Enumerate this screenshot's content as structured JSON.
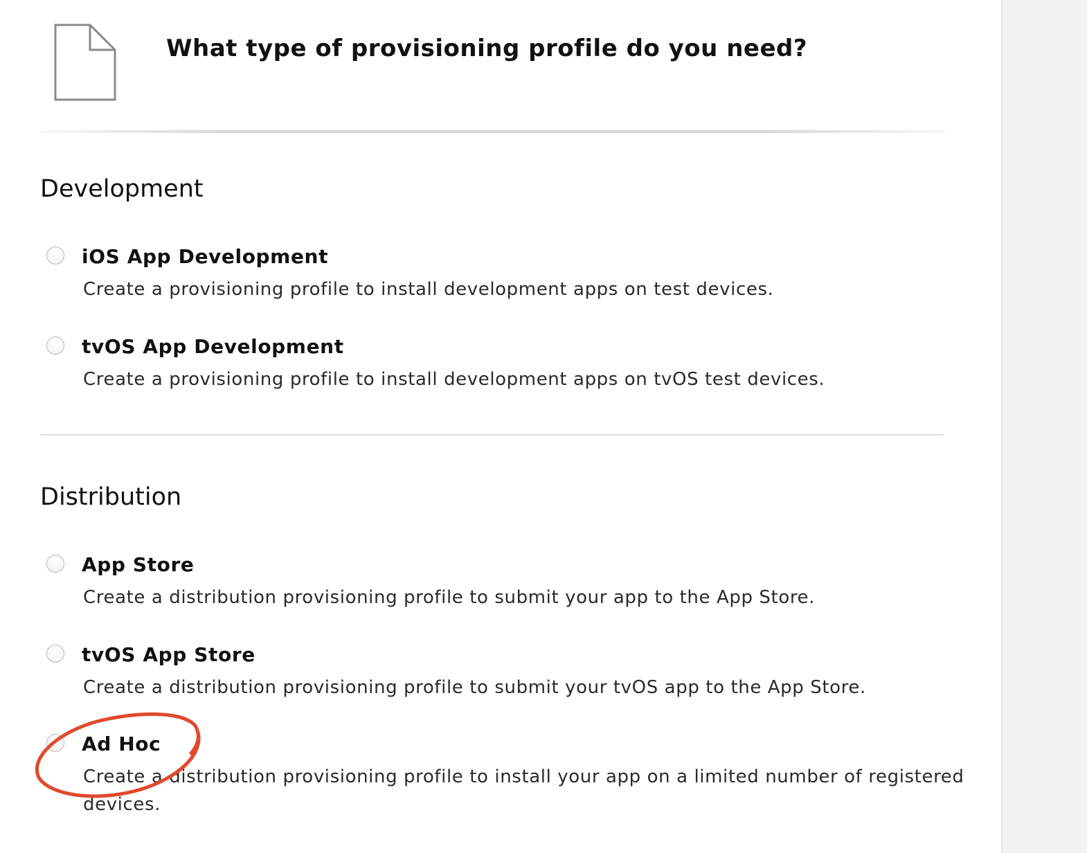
{
  "header": {
    "title": "What type of provisioning profile do you need?"
  },
  "development": {
    "heading": "Development",
    "options": [
      {
        "title": "iOS App Development",
        "description": "Create a provisioning profile to install development apps on test devices."
      },
      {
        "title": "tvOS App Development",
        "description": "Create a provisioning profile to install development apps on tvOS test devices."
      }
    ]
  },
  "distribution": {
    "heading": "Distribution",
    "options": [
      {
        "title": "App Store",
        "description": "Create a distribution provisioning profile to submit your app to the App Store."
      },
      {
        "title": "tvOS App Store",
        "description": "Create a distribution provisioning profile to submit your tvOS app to the App Store."
      },
      {
        "title": "Ad Hoc",
        "description": "Create a distribution provisioning profile to install your app on a limited number of registered devices."
      }
    ]
  },
  "icons": {
    "header_icon": "document-icon",
    "annotation": "red-ellipse-highlight"
  },
  "colors": {
    "annotation": "#e04a2c",
    "radio_border": "#b9b9b9",
    "divider": "#dcdcdc"
  }
}
